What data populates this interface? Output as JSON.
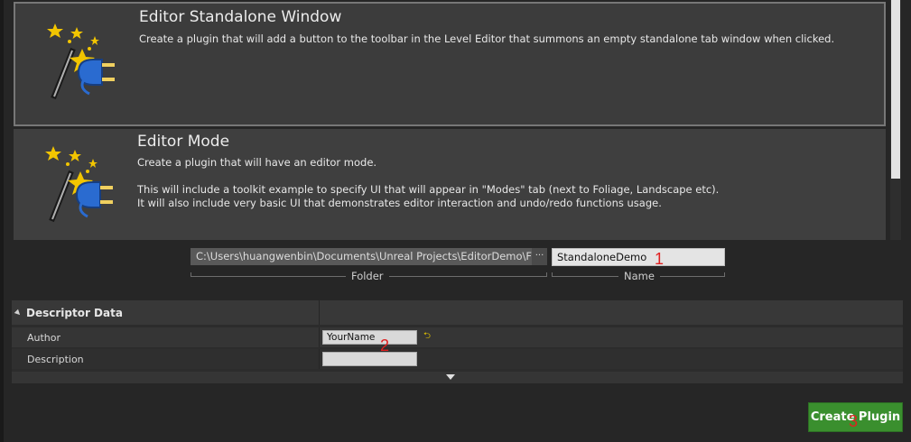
{
  "templates": [
    {
      "title": "Editor Standalone Window",
      "description": "Create a plugin that will add a button to the toolbar in the Level Editor that summons an empty standalone tab window when clicked.",
      "icon": "magic-wand-plug-icon",
      "selected": true
    },
    {
      "title": "Editor Mode",
      "description_lines": [
        "Create a plugin that will have an editor mode.",
        "",
        "This will include a toolkit example to specify UI that will appear in \"Modes\" tab (next to Foliage, Landscape etc).",
        "It will also include very basic UI that demonstrates editor interaction and undo/redo functions usage."
      ],
      "icon": "magic-wand-plug-icon",
      "selected": false
    }
  ],
  "plugin_location": {
    "folder_value": "C:\\Users\\huangwenbin\\Documents\\Unreal Projects\\EditorDemo\\F",
    "browse_label": "···",
    "folder_caption": "Folder",
    "name_value": "StandaloneDemo",
    "name_caption": "Name"
  },
  "descriptor": {
    "header": "Descriptor Data",
    "rows": [
      {
        "label": "Author",
        "value": "YourName"
      },
      {
        "label": "Description",
        "value": ""
      }
    ]
  },
  "create_button": {
    "label": "Create Plugin",
    "color": "#3a8f2e"
  },
  "annotations": [
    "1",
    "2",
    "3"
  ]
}
